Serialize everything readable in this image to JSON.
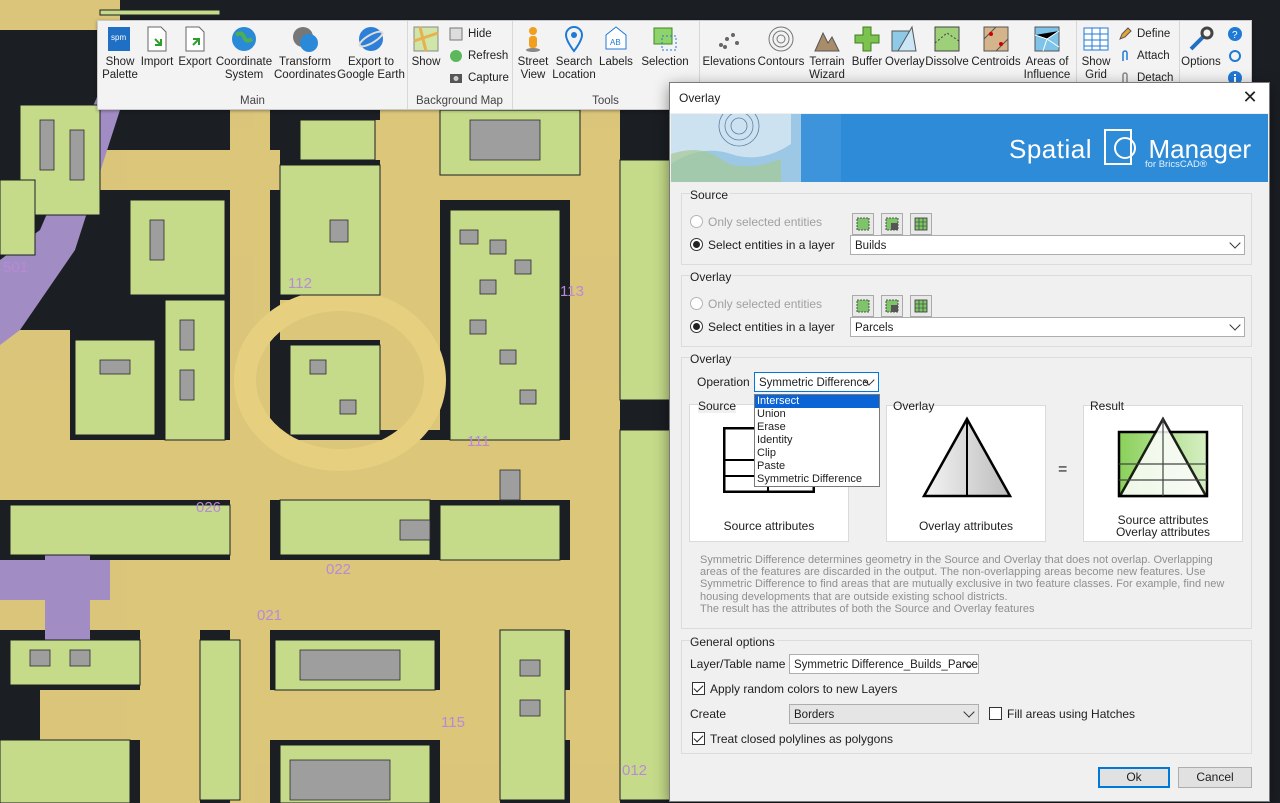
{
  "ribbon": {
    "groups": [
      {
        "caption": "Main",
        "buttons": [
          "Show Palette",
          "Import",
          "Export",
          "Coordinate System",
          "Transform Coordinates",
          "Export to Google Earth"
        ]
      },
      {
        "caption": "Background Map",
        "buttons": [
          "Show"
        ],
        "small": [
          "Hide",
          "Refresh",
          "Capture"
        ]
      },
      {
        "caption": "Tools",
        "buttons": [
          "Street View",
          "Search Location",
          "Labels",
          "Selection"
        ]
      },
      {
        "caption": "",
        "buttons": [
          "Elevations",
          "Contours",
          "Terrain Wizard",
          "Buffer",
          "Overlay",
          "Dissolve",
          "Centroids",
          "Areas of Influence"
        ]
      },
      {
        "caption": "",
        "buttons": [
          "Show Grid"
        ],
        "small": [
          "Define",
          "Attach",
          "Detach"
        ]
      },
      {
        "caption": "",
        "buttons": [
          "Options"
        ]
      }
    ]
  },
  "map": {
    "labels": [
      "501",
      "112",
      "026",
      "022",
      "021",
      "111",
      "113",
      "115",
      "012"
    ]
  },
  "dialog": {
    "title": "Overlay",
    "brand": {
      "word1": "Spatial",
      "logo_text": "spm",
      "word2": "Manager",
      "sub": "for BricsCAD®"
    },
    "source": {
      "title": "Source",
      "opt_selected": "Only selected entities",
      "opt_layer": "Select entities in a layer",
      "layer": "Builds"
    },
    "overlay": {
      "title": "Overlay",
      "opt_selected": "Only selected entities",
      "opt_layer": "Select entities in a layer",
      "layer": "Parcels"
    },
    "operation": {
      "title": "Overlay",
      "label": "Operation",
      "value": "Symmetric Difference",
      "options": [
        "Intersect",
        "Union",
        "Erase",
        "Identity",
        "Clip",
        "Paste",
        "Symmetric Difference"
      ],
      "highlighted": "Intersect",
      "panels": {
        "source_label": "Source",
        "source_caption": "Source attributes",
        "overlay_label": "Overlay",
        "overlay_caption": "Overlay attributes",
        "result_label": "Result",
        "result_caption_1": "Source attributes",
        "result_caption_2": "Overlay attributes",
        "equals": "="
      },
      "description": "Symmetric Difference determines geometry in the Source and Overlay that does not overlap. Overlapping areas of the features are discarded in the output. The non-overlapping areas become new features. Use Symmetric Difference to find areas that are mutually exclusive in two feature classes. For example, find new housing developments that are outside existing school districts.",
      "description_2": "The result has the attributes of both the Source and Overlay features"
    },
    "general": {
      "title": "General options",
      "layer_name_label": "Layer/Table name",
      "layer_name_value": "Symmetric Difference_Builds_Parce",
      "random_colors_label": "Apply random colors to new Layers",
      "random_colors": true,
      "create_label": "Create",
      "create_value": "Borders",
      "fill_label": "Fill areas using Hatches",
      "fill": false,
      "closed_polylines_label": "Treat closed polylines as polygons",
      "closed_polylines": true
    },
    "ok_label": "Ok",
    "cancel_label": "Cancel"
  },
  "colors": {
    "accent": "#0078d7",
    "banner": "#2e8bd8",
    "parcel": "#c7dc8a",
    "buffer": "#e7cf7d",
    "road": "#a48dc1"
  }
}
